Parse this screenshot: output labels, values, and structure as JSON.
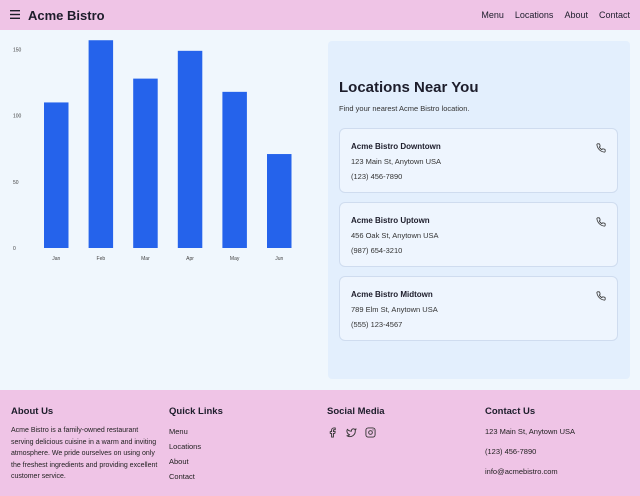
{
  "header": {
    "brand": "Acme Bistro",
    "nav": [
      "Menu",
      "Locations",
      "About",
      "Contact"
    ]
  },
  "chart_data": {
    "type": "bar",
    "categories": [
      "Jan",
      "Feb",
      "Mar",
      "Apr",
      "May",
      "Jun"
    ],
    "values": [
      110,
      157,
      128,
      149,
      118,
      71
    ],
    "ylim": [
      0,
      150
    ],
    "yticks": [
      0,
      50,
      100,
      150
    ],
    "color": "#2563eb",
    "grid": false,
    "title": "",
    "xlabel": "",
    "ylabel": ""
  },
  "locations": {
    "title": "Locations Near You",
    "subtitle": "Find your nearest Acme Bistro location.",
    "items": [
      {
        "name": "Acme Bistro Downtown",
        "address": "123 Main St, Anytown USA",
        "phone": "(123) 456-7890"
      },
      {
        "name": "Acme Bistro Uptown",
        "address": "456 Oak St, Anytown USA",
        "phone": "(987) 654-3210"
      },
      {
        "name": "Acme Bistro Midtown",
        "address": "789 Elm St, Anytown USA",
        "phone": "(555) 123-4567"
      }
    ]
  },
  "footer": {
    "about_title": "About Us",
    "about_text": "Acme Bistro is a family-owned restaurant serving delicious cuisine in a warm and inviting atmosphere. We pride ourselves on using only the freshest ingredients and providing excellent customer service.",
    "links_title": "Quick Links",
    "links": [
      "Menu",
      "Locations",
      "About",
      "Contact"
    ],
    "social_title": "Social Media",
    "social_icons": [
      "facebook-icon",
      "twitter-icon",
      "instagram-icon"
    ],
    "contact_title": "Contact Us",
    "contact_address": "123 Main St, Anytown USA",
    "contact_phone": "(123) 456-7890",
    "contact_email": "info@acmebistro.com"
  }
}
